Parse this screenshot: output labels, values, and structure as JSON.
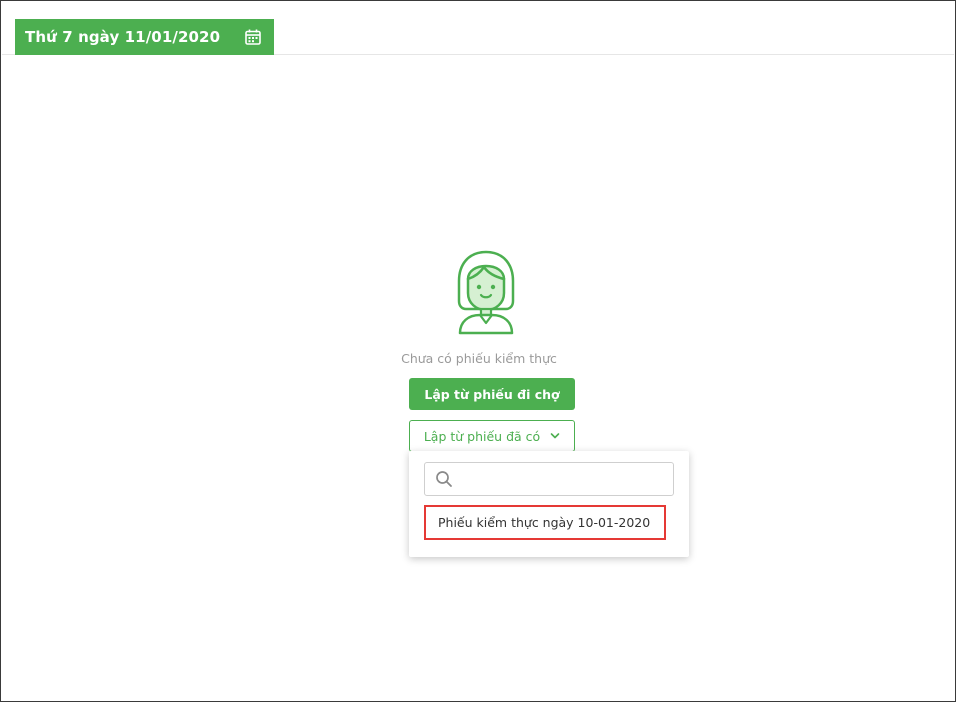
{
  "header": {
    "date_label": "Thứ 7 ngày 11/01/2020",
    "calendar_icon": "calendar-icon"
  },
  "empty_state": {
    "illustration": "girl-avatar-illustration",
    "message": "Chưa có phiếu kiểm thực"
  },
  "actions": {
    "create_from_market_label": "Lập từ phiếu đi chợ",
    "create_from_existing_label": "Lập từ phiếu đã có",
    "dropdown_icon": "chevron-down-icon"
  },
  "dropdown": {
    "search_placeholder": "",
    "search_value": "",
    "search_icon": "search-icon",
    "options": [
      {
        "label": "Phiếu kiểm thực ngày 10-01-2020",
        "highlighted": true
      }
    ]
  },
  "colors": {
    "primary": "#4caf50",
    "highlight_border": "#e53935",
    "muted_text": "#9a9a9a"
  }
}
